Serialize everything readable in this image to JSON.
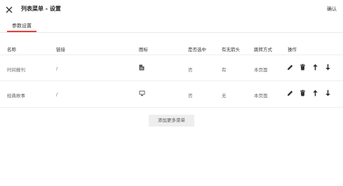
{
  "header": {
    "title": "列表菜单 - 设置",
    "confirm_label": "确认"
  },
  "tabs": [
    {
      "label": "参数设置",
      "active": true
    }
  ],
  "table": {
    "columns": [
      "名称",
      "链接",
      "图标",
      "是否选中",
      "有无箭头",
      "跳转方式",
      "操作"
    ],
    "rows": [
      {
        "name": "时间报刊",
        "link": "/",
        "icon": "document-icon",
        "selected": "否",
        "arrow": "有",
        "jump": "本页面"
      },
      {
        "name": "经典故事",
        "link": "/",
        "icon": "monitor-icon",
        "selected": "否",
        "arrow": "无",
        "jump": "本页面"
      }
    ]
  },
  "add_button_label": "添加更多菜单",
  "colors": {
    "accent": "#e0413a"
  }
}
